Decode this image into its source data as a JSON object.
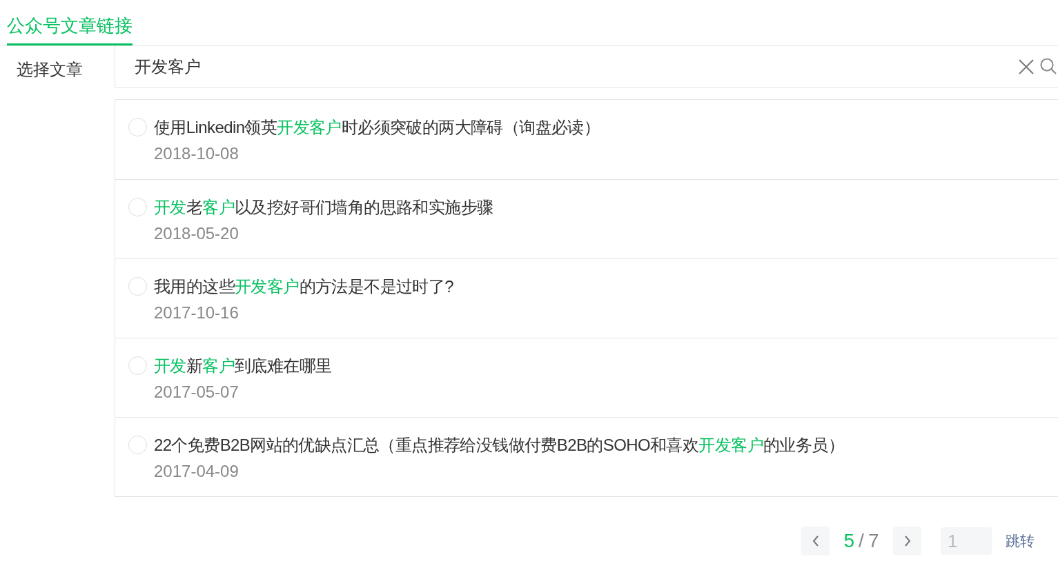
{
  "tabs": [
    {
      "label": "公众号文章链接",
      "selected": true
    }
  ],
  "field_label": "选择文章",
  "search": {
    "value": "开发客户"
  },
  "articles": [
    {
      "selected": false,
      "title": [
        {
          "text": "使用Linkedin领英",
          "highlight": false
        },
        {
          "text": "开发客户",
          "highlight": true
        },
        {
          "text": "时必须突破的两大障碍（询盘必读）",
          "highlight": false
        }
      ],
      "date": "2018-10-08"
    },
    {
      "selected": false,
      "title": [
        {
          "text": "开发",
          "highlight": true
        },
        {
          "text": "老",
          "highlight": false
        },
        {
          "text": "客户",
          "highlight": true
        },
        {
          "text": "以及挖好哥们墙角的思路和实施步骤",
          "highlight": false
        }
      ],
      "date": "2018-05-20"
    },
    {
      "selected": false,
      "title": [
        {
          "text": "我用的这些",
          "highlight": false
        },
        {
          "text": "开发客户",
          "highlight": true
        },
        {
          "text": "的方法是不是过时了?",
          "highlight": false
        }
      ],
      "date": "2017-10-16"
    },
    {
      "selected": false,
      "title": [
        {
          "text": "开发",
          "highlight": true
        },
        {
          "text": "新",
          "highlight": false
        },
        {
          "text": "客户",
          "highlight": true
        },
        {
          "text": "到底难在哪里",
          "highlight": false
        }
      ],
      "date": "2017-05-07"
    },
    {
      "selected": false,
      "title": [
        {
          "text": "22个免费B2B网站的优缺点汇总（重点推荐给没钱做付费B2B的SOHO和喜欢",
          "highlight": false
        },
        {
          "text": "开发客户",
          "highlight": true
        },
        {
          "text": "的业务员）",
          "highlight": false
        }
      ],
      "date": "2017-04-09"
    }
  ],
  "pagination": {
    "current": "5",
    "separator": "/",
    "total": "7",
    "jump_value": "1",
    "jump_label": "跳转"
  }
}
